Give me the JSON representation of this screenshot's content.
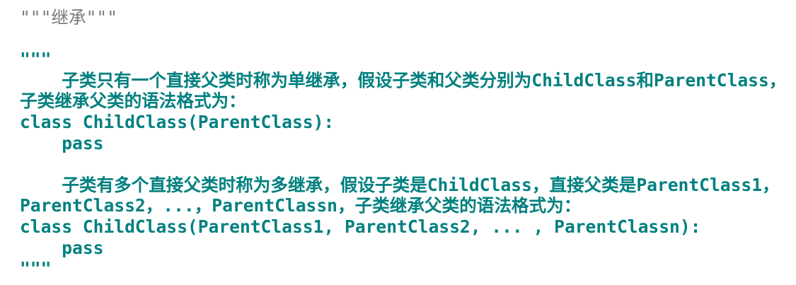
{
  "editor": {
    "lines": [
      "\"\"\"继承\"\"\"",
      "",
      "\"\"\"",
      "    子类只有一个直接父类时称为单继承，假设子类和父类分别为ChildClass和ParentClass，",
      "子类继承父类的语法格式为：",
      "class ChildClass(ParentClass):",
      "    pass",
      "",
      "    子类有多个直接父类时称为多继承，假设子类是ChildClass，直接父类是ParentClass1，",
      "ParentClass2，...，ParentClassn，子类继承父类的语法格式为：",
      "class ChildClass(ParentClass1, ParentClass2, ... , ParentClassn):",
      "    pass",
      "\"\"\""
    ],
    "colors": {
      "docstring": "#00807f",
      "comment": "#7a7a7a",
      "background": "#ffffff"
    }
  }
}
